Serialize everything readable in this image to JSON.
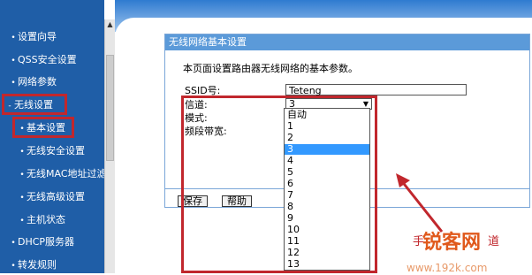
{
  "sidebar": {
    "items": [
      {
        "label": "设置向导"
      },
      {
        "label": "QSS安全设置"
      },
      {
        "label": "网络参数"
      },
      {
        "label": "无线设置"
      },
      {
        "label": "基本设置"
      },
      {
        "label": "无线安全设置"
      },
      {
        "label": "无线MAC地址过滤"
      },
      {
        "label": "无线高级设置"
      },
      {
        "label": "主机状态"
      },
      {
        "label": "DHCP服务器"
      },
      {
        "label": "转发规则"
      }
    ]
  },
  "panel": {
    "title": "无线网络基本设置",
    "description": "本页面设置路由器无线网络的基本参数。",
    "ssid_label": "SSID号:",
    "ssid_value": "Teteng",
    "channel_label": "信道:",
    "channel_value": "3",
    "mode_label": "模式:",
    "bandwidth_label": "频段带宽:",
    "save_label": "保存",
    "help_label": "帮助"
  },
  "dropdown": {
    "options": [
      "自动",
      "1",
      "2",
      "3",
      "4",
      "5",
      "6",
      "7",
      "8",
      "9",
      "10",
      "11",
      "12",
      "13"
    ],
    "selected": "3"
  },
  "annotation": {
    "caption": "手",
    "caption_tail": "道",
    "watermark": "锐客网",
    "watermark_url": "www.192k.com"
  },
  "colors": {
    "sidebar": "#1f5ea7",
    "highlight_red": "#c1272d",
    "selected_option": "#3399ff",
    "panel_header": "#5b9ad9"
  }
}
